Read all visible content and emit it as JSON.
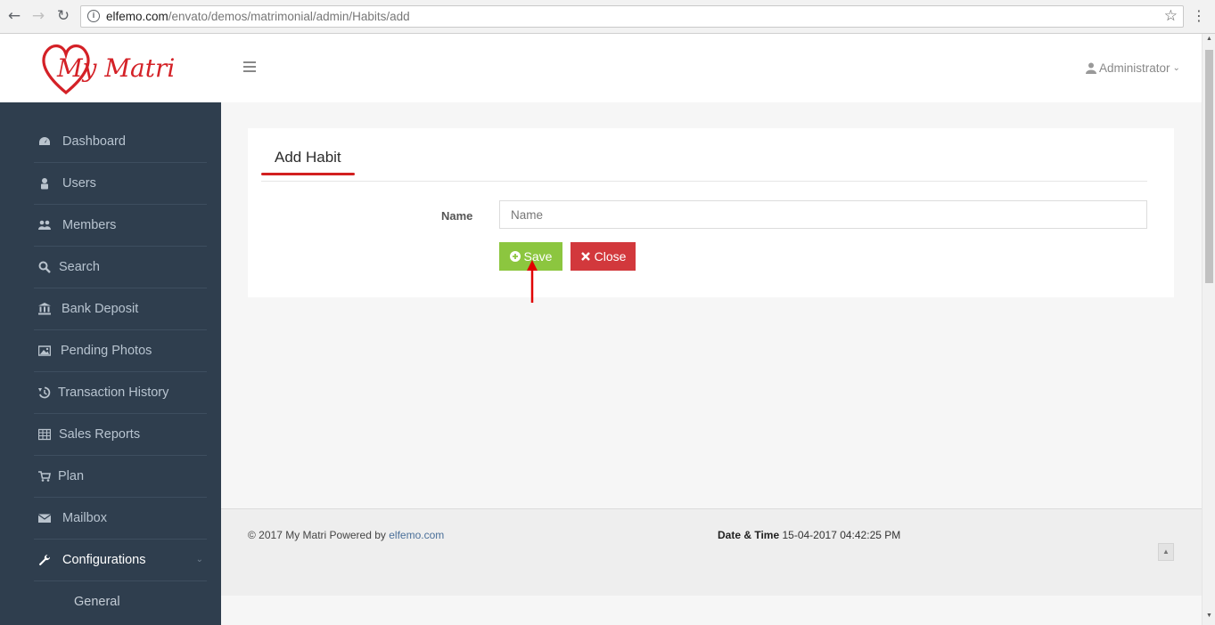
{
  "browser": {
    "url_host": "elfemo.com",
    "url_path": "/envato/demos/matrimonial/admin/Habits/add"
  },
  "header": {
    "brand": "My Matri",
    "user_label": "Administrator"
  },
  "sidebar": {
    "items": [
      {
        "label": "Dashboard",
        "icon": "dashboard-icon"
      },
      {
        "label": "Users",
        "icon": "user-icon"
      },
      {
        "label": "Members",
        "icon": "users-icon"
      },
      {
        "label": "Search",
        "icon": "search-icon"
      },
      {
        "label": "Bank Deposit",
        "icon": "bank-icon"
      },
      {
        "label": "Pending Photos",
        "icon": "photo-icon"
      },
      {
        "label": "Transaction History",
        "icon": "history-icon"
      },
      {
        "label": "Sales Reports",
        "icon": "table-icon"
      },
      {
        "label": "Plan",
        "icon": "cart-icon"
      },
      {
        "label": "Mailbox",
        "icon": "envelope-icon"
      },
      {
        "label": "Configurations",
        "icon": "wrench-icon"
      }
    ],
    "submenu": {
      "label": "General"
    }
  },
  "form": {
    "title": "Add Habit",
    "name_label": "Name",
    "name_placeholder": "Name",
    "name_value": "",
    "save_label": "Save",
    "close_label": "Close"
  },
  "footer": {
    "copyright_prefix": "© 2017 My Matri Powered by ",
    "copyright_link": "elfemo.com",
    "datetime_label": "Date & Time",
    "datetime_value": "15-04-2017 04:42:25 PM"
  },
  "colors": {
    "sidebar_bg": "#2f3e4e",
    "accent_red": "#d21f1f",
    "save_green": "#8cc63f",
    "close_red": "#d2383c"
  }
}
